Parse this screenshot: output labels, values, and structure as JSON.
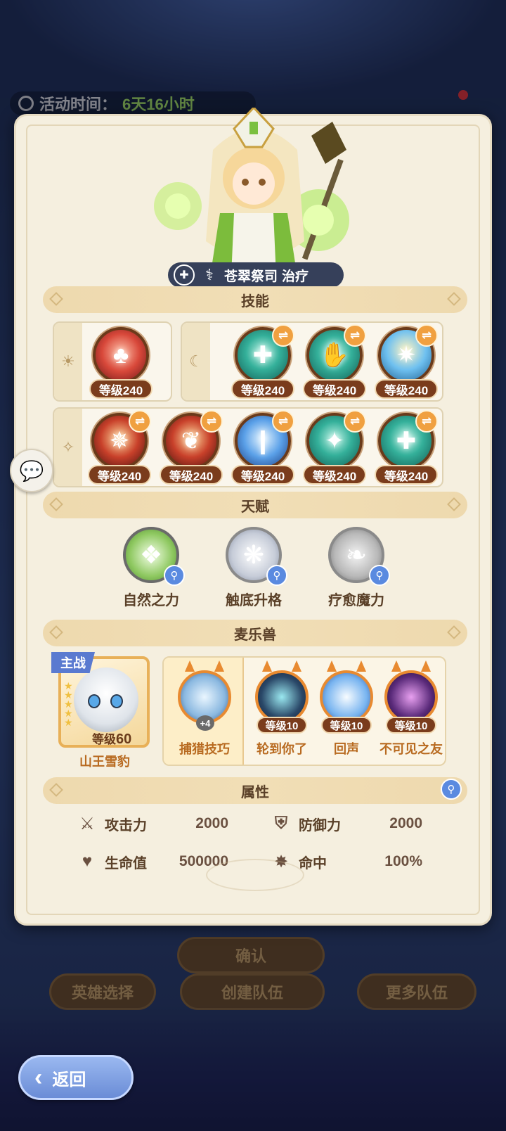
{
  "background": {
    "event_label": "活动时间：",
    "event_time": "6天16小时",
    "confirm_btn": "确认",
    "hero_select_btn": "英雄选择",
    "create_team_btn": "创建队伍",
    "more_teams_btn": "更多队伍"
  },
  "hero": {
    "name": "苍翠祭司",
    "role": "治疗"
  },
  "sections": {
    "skills": "技能",
    "talents": "天赋",
    "pets": "麦乐兽",
    "attributes": "属性"
  },
  "skills": {
    "row1_left": [
      {
        "level": "等级240",
        "swap": false,
        "icon": "rose-priestess-icon"
      }
    ],
    "row1_right": [
      {
        "level": "等级240",
        "swap": true,
        "icon": "healing-cross-icon"
      },
      {
        "level": "等级240",
        "swap": true,
        "icon": "healing-hand-icon"
      },
      {
        "level": "等级240",
        "swap": true,
        "icon": "light-burst-icon"
      }
    ],
    "row2": [
      {
        "level": "等级240",
        "swap": true,
        "icon": "ember-sigil-icon"
      },
      {
        "level": "等级240",
        "swap": true,
        "icon": "flame-dragon-icon"
      },
      {
        "level": "等级240",
        "swap": true,
        "icon": "light-pillar-icon"
      },
      {
        "level": "等级240",
        "swap": true,
        "icon": "star-burst-icon"
      },
      {
        "level": "等级240",
        "swap": true,
        "icon": "green-cross-icon"
      }
    ]
  },
  "talents": [
    {
      "name": "自然之力",
      "icon": "nature-crystal-icon"
    },
    {
      "name": "触底升格",
      "icon": "silver-flower-icon"
    },
    {
      "name": "疗愈魔力",
      "icon": "silver-leaf-icon"
    }
  ],
  "pet": {
    "tag": "主战",
    "level_prefix": "等级",
    "level": "60",
    "name": "山王雪豹",
    "stars": 5
  },
  "pet_skills": [
    {
      "name": "捕猎技巧",
      "level": "",
      "badge": "+4"
    },
    {
      "name": "轮到你了",
      "level": "等级10"
    },
    {
      "name": "回声",
      "level": "等级10"
    },
    {
      "name": "不可见之友",
      "level": "等级10"
    }
  ],
  "attributes": [
    {
      "label": "攻击力",
      "value": "2000",
      "icon": "crossed-swords-icon"
    },
    {
      "label": "防御力",
      "value": "2000",
      "icon": "shield-icon"
    },
    {
      "label": "生命值",
      "value": "500000",
      "icon": "heart-icon"
    },
    {
      "label": "命中",
      "value": "100%",
      "icon": "star-burst-icon"
    }
  ],
  "back_btn": "返回"
}
